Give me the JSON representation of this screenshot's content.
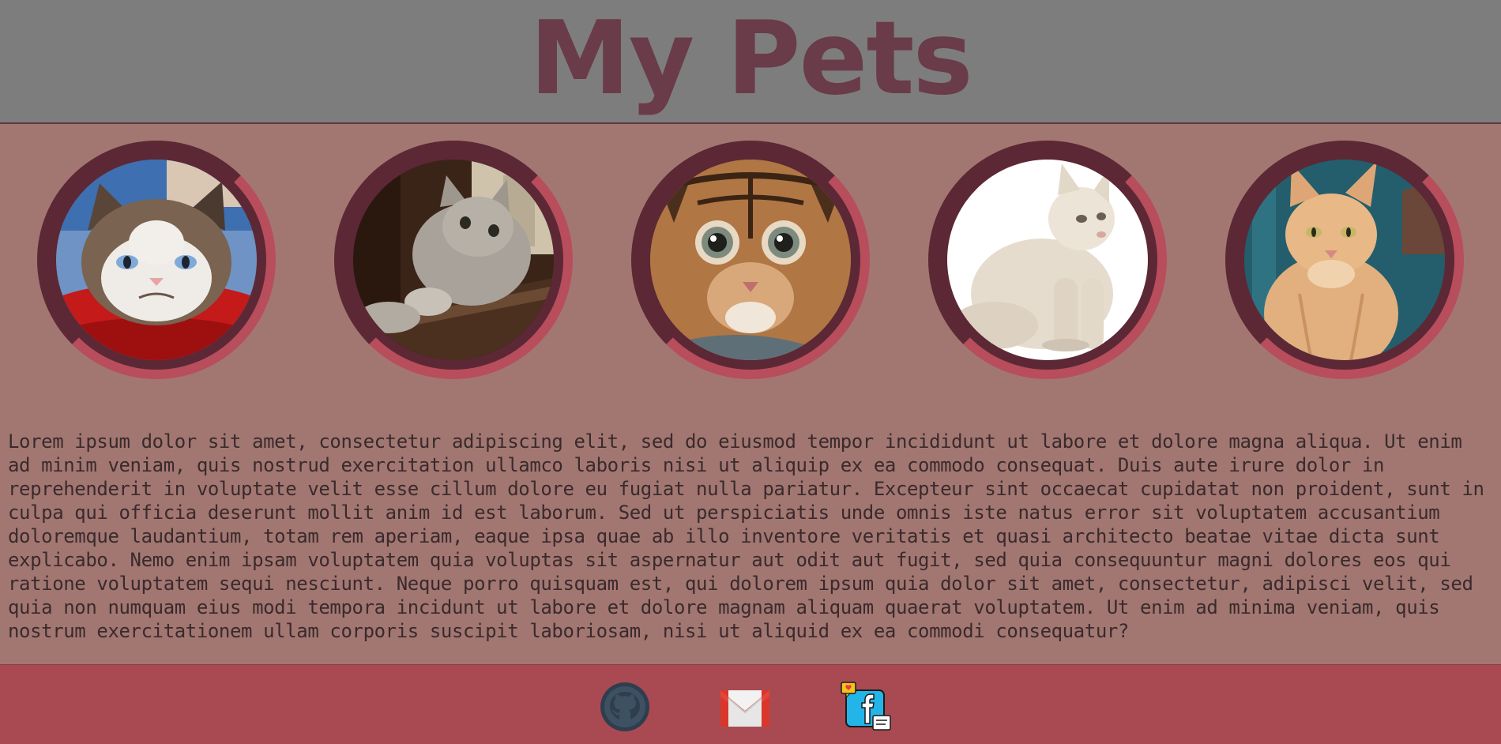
{
  "header": {
    "title": "My Pets"
  },
  "gallery": {
    "pets": [
      {
        "icon": "grumpy-cat-photo"
      },
      {
        "icon": "gray-cat-photo"
      },
      {
        "icon": "tabby-kitten-photo"
      },
      {
        "icon": "white-cat-photo"
      },
      {
        "icon": "orange-cat-photo"
      }
    ]
  },
  "content": {
    "paragraph": "Lorem ipsum dolor sit amet, consectetur adipiscing elit, sed do eiusmod tempor incididunt ut labore et dolore magna aliqua. Ut enim ad minim veniam, quis nostrud exercitation ullamco laboris nisi ut aliquip ex ea commodo consequat. Duis aute irure dolor in reprehenderit in voluptate velit esse cillum dolore eu fugiat nulla pariatur. Excepteur sint occaecat cupidatat non proident, sunt in culpa qui officia deserunt mollit anim id est laborum. Sed ut perspiciatis unde omnis iste natus error sit voluptatem accusantium doloremque laudantium, totam rem aperiam, eaque ipsa quae ab illo inventore veritatis et quasi architecto beatae vitae dicta sunt explicabo. Nemo enim ipsam voluptatem quia voluptas sit aspernatur aut odit aut fugit, sed quia consequuntur magni dolores eos qui ratione voluptatem sequi nesciunt. Neque porro quisquam est, qui dolorem ipsum quia dolor sit amet, consectetur, adipisci velit, sed quia non numquam eius modi tempora incidunt ut labore et dolore magnam aliquam quaerat voluptatem. Ut enim ad minima veniam, quis nostrum exercitationem ullam corporis suscipit laboriosam, nisi ut aliquid ex ea commodi consequatur?"
  },
  "footer": {
    "links": [
      {
        "icon": "github-icon"
      },
      {
        "icon": "gmail-icon"
      },
      {
        "icon": "facebook-icon"
      }
    ]
  },
  "colors": {
    "header_bg": "#7d7d7d",
    "title": "#6a3b49",
    "page_bg": "#a27771",
    "ring_dark": "#5c2835",
    "ring_light": "#b84d5c",
    "footer_bg": "#a94a52"
  }
}
